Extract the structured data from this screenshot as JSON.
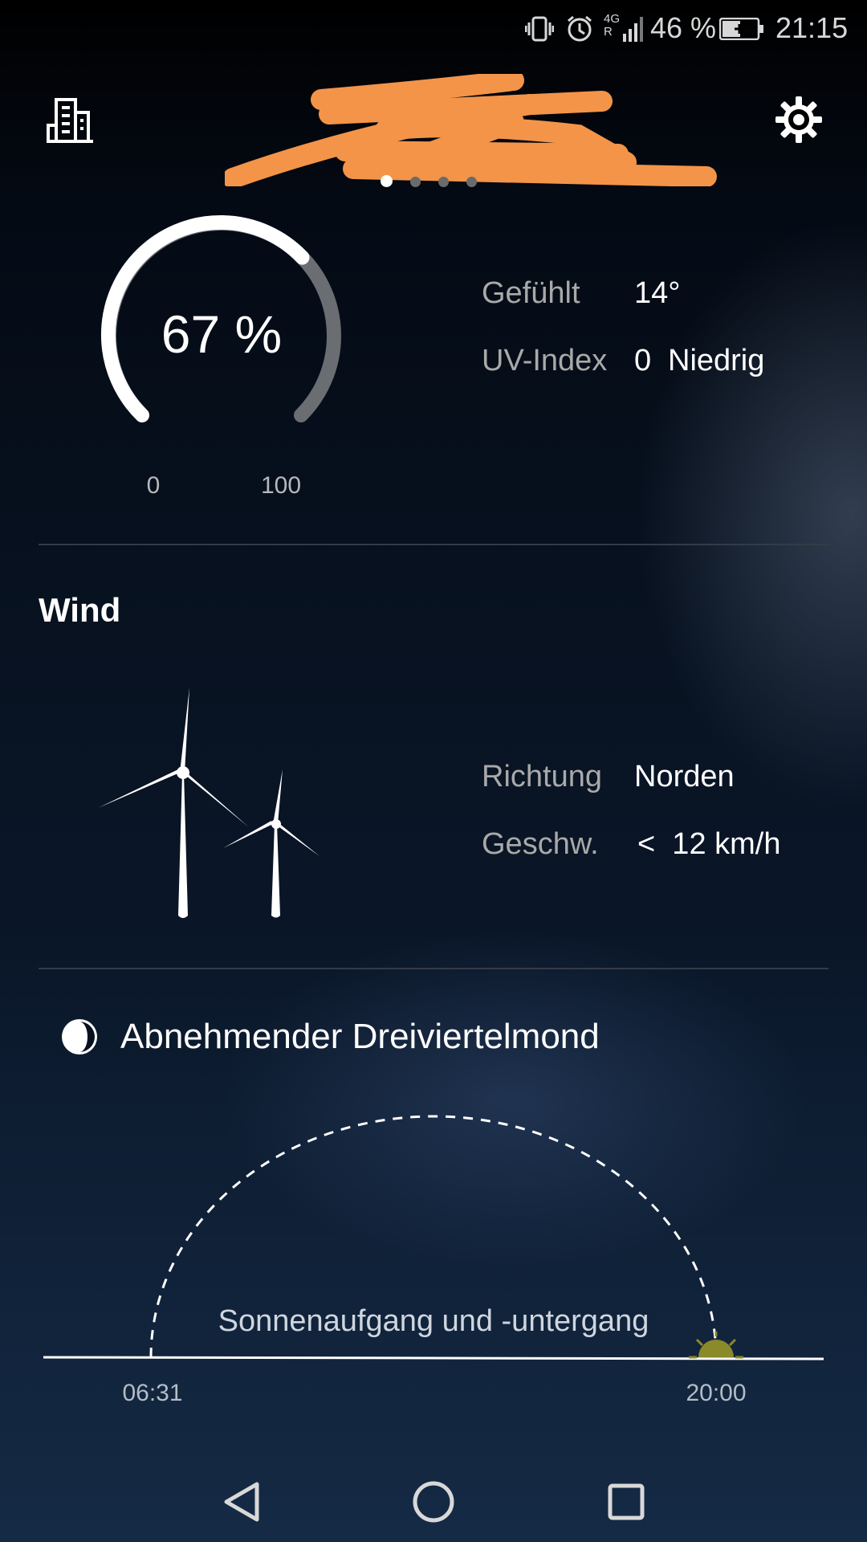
{
  "status_bar": {
    "network": "4G R",
    "battery": "46 %",
    "time": "21:15",
    "icons": [
      "vibrate-icon",
      "alarm-icon",
      "signal-icon",
      "battery-charging-icon"
    ]
  },
  "header": {
    "city_icon": "city-buildings-icon",
    "settings_icon": "gear-icon",
    "location_obscured": true,
    "pages_total": 4,
    "active_page": 1
  },
  "humidity": {
    "value": 67,
    "display": "67 %",
    "min_label": "0",
    "max_label": "100",
    "colors": {
      "fill": "#ffffff",
      "track": "#6a6d72"
    }
  },
  "details": [
    {
      "label": "Gefühlt",
      "value": "14°"
    },
    {
      "label": "UV-Index",
      "value": "0",
      "extra": "Niedrig"
    }
  ],
  "wind": {
    "title": "Wind",
    "icon": "wind-turbine-icon",
    "direction_label": "Richtung",
    "direction_value": "Norden",
    "speed_label": "Geschw.",
    "speed_value": "<  12 km/h"
  },
  "moon": {
    "icon": "moon-phase-icon",
    "phase": "Abnehmender Dreiviertelmond"
  },
  "sun": {
    "caption": "Sonnenaufgang und -untergang",
    "sunrise": "06:31",
    "sunset": "20:00",
    "progress": 0.995,
    "sun_color": "#8a8a2a"
  },
  "navbar": [
    "back-icon",
    "home-icon",
    "recents-icon"
  ]
}
